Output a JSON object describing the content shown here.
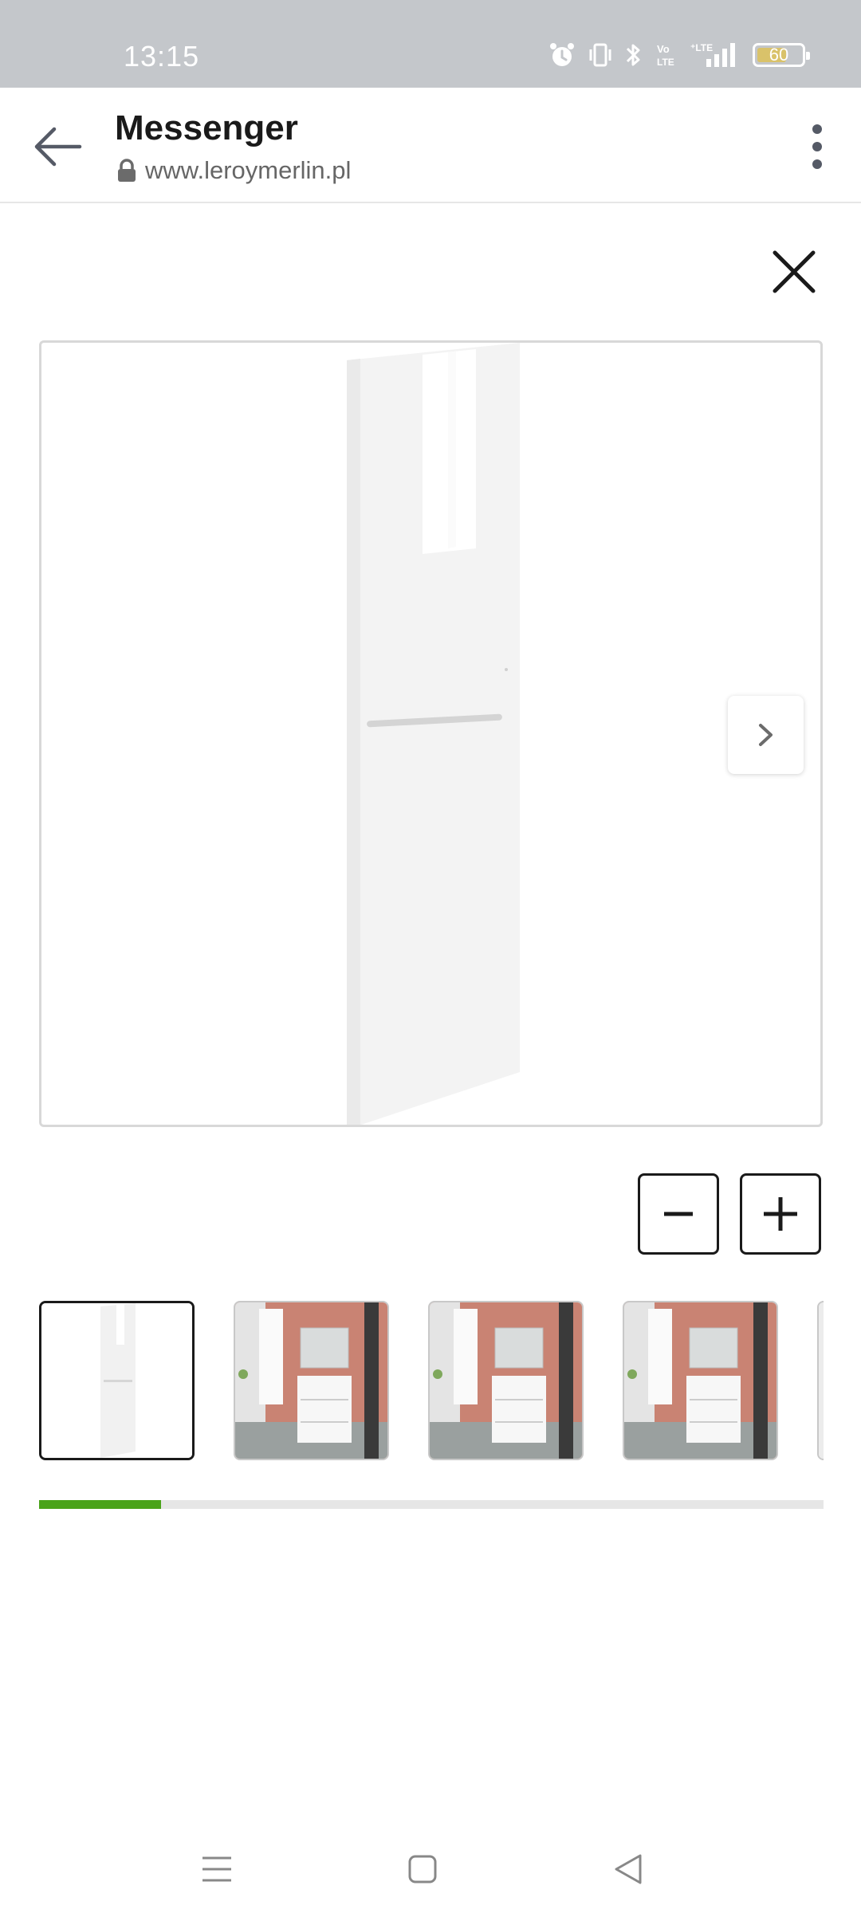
{
  "status_bar": {
    "time": "13:15",
    "battery_level": "60",
    "icons": [
      "alarm-icon",
      "vibrate-icon",
      "bluetooth-icon",
      "volte-icon",
      "lte-signal-icon",
      "battery-icon"
    ]
  },
  "app_bar": {
    "title": "Messenger",
    "url": "www.leroymerlin.pl",
    "back_icon": "back-arrow-icon",
    "lock_icon": "lock-icon",
    "menu_icon": "more-vertical-icon"
  },
  "gallery": {
    "close_icon": "close-icon",
    "next_icon": "chevron-right-icon",
    "zoom_out_icon": "minus-icon",
    "zoom_in_icon": "plus-icon",
    "thumbnails": [
      {
        "kind": "product-white-panel",
        "active": true
      },
      {
        "kind": "bathroom-scene",
        "active": false
      },
      {
        "kind": "bathroom-scene",
        "active": false
      },
      {
        "kind": "bathroom-scene",
        "active": false
      },
      {
        "kind": "partial",
        "active": false
      }
    ],
    "scroll_progress": 0.155
  },
  "nav_bar": {
    "icons": [
      "recents-icon",
      "home-icon",
      "back-triangle-icon"
    ]
  },
  "colors": {
    "status_bar_bg": "#c4c7cb",
    "progress_fill": "#4aa31a",
    "progress_track": "#e6e6e6",
    "bathroom_wall": "#c98373"
  }
}
